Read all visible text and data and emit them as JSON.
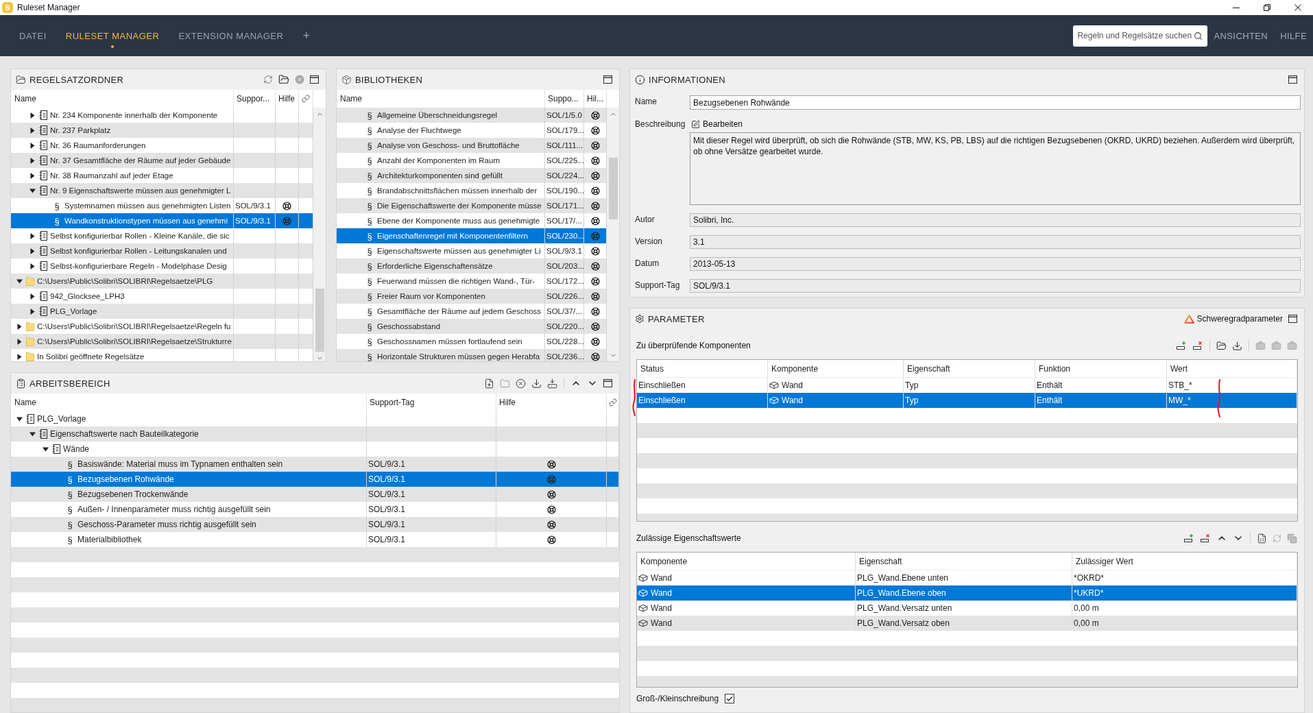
{
  "title_bar": {
    "logo_text": "S",
    "title": "Ruleset Manager"
  },
  "menu_bar": {
    "tabs": [
      {
        "label": "DATEI",
        "selected": false
      },
      {
        "label": "RULESET MANAGER",
        "selected": true
      },
      {
        "label": "EXTENSION MANAGER",
        "selected": false
      }
    ],
    "add_tab": "+",
    "search": {
      "placeholder": "Regeln und Regelsätze suchen"
    },
    "menus": [
      "ANSICHTEN",
      "HILFE"
    ]
  },
  "regelsatzordner": {
    "title": "REGELSATZORDNER",
    "columns": [
      "Name",
      "Suppor...",
      "Hilfe"
    ],
    "partial_branch": [
      {
        "kind": "ruleset",
        "label": "Nr. 234 Komponente innerhalb der Komponente",
        "expanded": false,
        "selected": false
      },
      {
        "kind": "ruleset",
        "label": "Nr. 237 Parkplatz",
        "expanded": false,
        "selected": false
      },
      {
        "kind": "ruleset",
        "label": "Nr. 36 Raumanforderungen",
        "expanded": false,
        "selected": false
      },
      {
        "kind": "ruleset",
        "label": "Nr. 37 Gesamtfläche der Räume auf jeder Gebäude",
        "expanded": false,
        "selected": false
      },
      {
        "kind": "ruleset",
        "label": "Nr. 38 Raumanzahl auf jeder Etage",
        "expanded": false,
        "selected": false
      },
      {
        "kind": "ruleset",
        "label": "Nr. 9 Eigenschaftswerte müssen aus genehmigter L",
        "expanded": true,
        "selected": false,
        "children": [
          {
            "kind": "rule",
            "symbol": "§",
            "label": "Systemnamen müssen aus genehmigten Listen",
            "support_tag": "SOL/9/3.1",
            "selected": false
          },
          {
            "kind": "rule",
            "symbol": "§",
            "label": "Wandkonstruktionstypen müssen aus genehmi",
            "support_tag": "SOL/9/3.1",
            "selected": true
          }
        ]
      },
      {
        "kind": "ruleset",
        "label": "Selbst konfigurierbar Rollen - Kleine Kanäle, die sic",
        "expanded": false,
        "selected": false
      },
      {
        "kind": "ruleset",
        "label": "Selbst konfigurierbar Rollen - Leitungskanalen und",
        "expanded": false,
        "selected": false
      },
      {
        "kind": "ruleset",
        "label": "Selbst-konfigurierbare Regeln - Modelphase Desig",
        "expanded": false,
        "selected": false
      }
    ],
    "tree": [
      {
        "kind": "folder",
        "label": "C:\\Users\\Public\\Solibri\\SOLIBRI\\Regelsaetze\\PLG",
        "expanded": true,
        "selected": false,
        "children": [
          {
            "kind": "ruleset",
            "label": "942_Glocksee_LPH3",
            "expanded": false,
            "selected": false
          },
          {
            "kind": "ruleset",
            "label": "PLG_Vorlage",
            "expanded": false,
            "selected": false
          }
        ]
      },
      {
        "kind": "folder",
        "label": "C:\\Users\\Public\\Solibri\\SOLIBRI\\Regelsaetze\\Regeln fu",
        "expanded": false,
        "selected": false
      },
      {
        "kind": "folder",
        "label": "C:\\Users\\Public\\Solibri\\SOLIBRI\\Regelsaetze\\Strukturre",
        "expanded": false,
        "selected": false
      },
      {
        "kind": "folder",
        "label": "In Solibri geöffnete Regelsätze",
        "expanded": false,
        "selected": false
      }
    ]
  },
  "bibliotheken": {
    "title": "BIBLIOTHEKEN",
    "columns": [
      "Name",
      "Suppo...",
      "Hil..."
    ],
    "rows": [
      {
        "symbol": "§",
        "label": "Allgemeine Überschneidungsregel",
        "support_tag": "SOL/1/5.0",
        "selected": false
      },
      {
        "symbol": "§",
        "label": "Analyse der Fluchtwege",
        "support_tag": "SOL/179...",
        "selected": false
      },
      {
        "symbol": "§",
        "label": "Analyse von Geschoss- und Bruttofläche",
        "support_tag": "SOL/111...",
        "selected": false
      },
      {
        "symbol": "§",
        "label": "Anzahl der Komponenten im Raum",
        "support_tag": "SOL/225...",
        "selected": false
      },
      {
        "symbol": "§",
        "label": "Architekturkomponenten sind gefüllt",
        "support_tag": "SOL/224...",
        "selected": false
      },
      {
        "symbol": "§",
        "label": "Brandabschnittsflächen müssen innerhalb der",
        "support_tag": "SOL/190...",
        "selected": false
      },
      {
        "symbol": "§",
        "label": "Die Eigenschaftswerte der Komponente müsse",
        "support_tag": "SOL/171...",
        "selected": false
      },
      {
        "symbol": "§",
        "label": "Ebene der Komponente muss aus genehmigte",
        "support_tag": "SOL/17/...",
        "selected": false
      },
      {
        "symbol": "§",
        "label": "Eigenschaftenregel mit Komponentenfiltern",
        "support_tag": "SOL/230...",
        "selected": true
      },
      {
        "symbol": "§",
        "label": "Eigenschaftswerte müssen aus genehmigter Li",
        "support_tag": "SOL/9/3.1",
        "selected": false
      },
      {
        "symbol": "§",
        "label": "Erforderliche Eigenschaftensätze",
        "support_tag": "SOL/203...",
        "selected": false
      },
      {
        "symbol": "§",
        "label": "Feuerwand müssen die richtigen Wand-, Tür-",
        "support_tag": "SOL/172...",
        "selected": false
      },
      {
        "symbol": "§",
        "label": "Freier Raum vor Komponenten",
        "support_tag": "SOL/226...",
        "selected": false
      },
      {
        "symbol": "§",
        "label": "Gesamtfläche der Räume auf jedem Geschoss",
        "support_tag": "SOL/37/...",
        "selected": false
      },
      {
        "symbol": "§",
        "label": "Geschossabstand",
        "support_tag": "SOL/220...",
        "selected": false
      },
      {
        "symbol": "§",
        "label": "Geschossnamen müssen fortlaufend sein",
        "support_tag": "SOL/228...",
        "selected": false
      },
      {
        "symbol": "§",
        "label": "Horizontale Strukturen müssen gegen Herabfa",
        "support_tag": "SOL/236...",
        "selected": false
      }
    ]
  },
  "informationen": {
    "title": "INFORMATIONEN",
    "fields": [
      {
        "kind": "text",
        "label": "Name",
        "value": "Bezugsebenen Rohwände"
      },
      {
        "kind": "description",
        "label": "Beschreibung",
        "button": "Bearbeiten",
        "value": "Mit dieser Regel wird überprüft, ob sich die Rohwände (STB, MW, KS, PB, LBS) auf die richtigen Bezugsebenen (OKRD, UKRD) beziehen. Außerdem wird überprüft, ob ohne Versätze gearbeitet wurde."
      },
      {
        "kind": "readonly",
        "label": "Autor",
        "value": "Solibri, Inc."
      },
      {
        "kind": "readonly",
        "label": "Version",
        "value": "3.1"
      },
      {
        "kind": "readonly",
        "label": "Datum",
        "value": "2013-05-13"
      },
      {
        "kind": "readonly",
        "label": "Support-Tag",
        "value": "SOL/9/3.1"
      }
    ]
  },
  "arbeitsbereich": {
    "title": "ARBEITSBEREICH",
    "columns": [
      "Name",
      "Support-Tag",
      "Hilfe"
    ],
    "tree": [
      {
        "kind": "ruleset",
        "label": "PLG_Vorlage",
        "expanded": true,
        "selected": false,
        "children": [
          {
            "kind": "ruleset",
            "label": "Eigenschaftswerte nach Bauteilkategorie",
            "expanded": true,
            "selected": false,
            "children": [
              {
                "kind": "ruleset",
                "label": "Wände",
                "expanded": true,
                "selected": false,
                "children": [
                  {
                    "kind": "rule",
                    "symbol": "§",
                    "label": "Basiswände: Material muss im Typnamen enthalten sein",
                    "support_tag": "SOL/9/3.1",
                    "selected": false
                  },
                  {
                    "kind": "rule",
                    "symbol": "§",
                    "label": "Bezugsebenen Rohwände",
                    "support_tag": "SOL/9/3.1",
                    "selected": true
                  },
                  {
                    "kind": "rule",
                    "symbol": "§",
                    "label": "Bezugsebenen Trockenwände",
                    "support_tag": "SOL/9/3.1",
                    "selected": false
                  },
                  {
                    "kind": "rule",
                    "symbol": "§",
                    "label": "Außen- / Innenparameter muss richtig ausgefüllt sein",
                    "support_tag": "SOL/9/3.1",
                    "selected": false
                  },
                  {
                    "kind": "rule",
                    "symbol": "§",
                    "label": "Geschoss-Parameter muss richtig ausgefüllt sein",
                    "support_tag": "SOL/9/3.1",
                    "selected": false
                  },
                  {
                    "kind": "rule",
                    "symbol": "§",
                    "label": "Materialbibliothek",
                    "support_tag": "SOL/9/3.1",
                    "selected": false
                  }
                ]
              }
            ]
          }
        ]
      }
    ]
  },
  "parameter": {
    "title": "PARAMETER",
    "severity_button": "Schweregradparameter",
    "components": {
      "title": "Zu überprüfende Komponenten",
      "columns": [
        "Status",
        "Komponente",
        "Eigenschaft",
        "Funktion",
        "Wert"
      ],
      "rows": [
        {
          "status": "Einschließen",
          "component": "Wand",
          "property": "Typ",
          "function": "Enthält",
          "value": "STB_*",
          "selected": false
        },
        {
          "status": "Einschließen",
          "component": "Wand",
          "property": "Typ",
          "function": "Enthält",
          "value": "MW_*",
          "selected": true
        }
      ]
    },
    "allowed_values": {
      "title": "Zulässige Eigenschaftswerte",
      "columns": [
        "Komponente",
        "Eigenschaft",
        "Zulässiger Wert"
      ],
      "rows": [
        {
          "component": "Wand",
          "property": "PLG_Wand.Ebene unten",
          "value": "*OKRD*",
          "selected": false
        },
        {
          "component": "Wand",
          "property": "PLG_Wand.Ebene oben",
          "value": "*UKRD*",
          "selected": true
        },
        {
          "component": "Wand",
          "property": "PLG_Wand.Versatz unten",
          "value": "0,00 m",
          "selected": false
        },
        {
          "component": "Wand",
          "property": "PLG_Wand.Versatz oben",
          "value": "0,00 m",
          "selected": false
        }
      ]
    },
    "case_sensitive": {
      "label": "Groß-/Kleinschreibung",
      "checked": true
    }
  }
}
